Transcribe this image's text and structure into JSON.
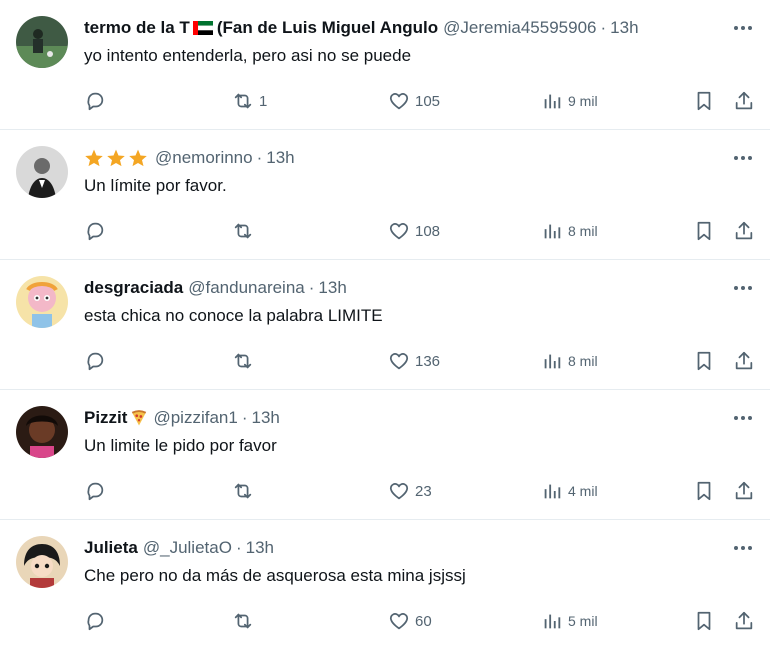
{
  "tweets": [
    {
      "name": "termo de la T",
      "name_suffix": "(Fan de Luis Miguel Angulo",
      "name_emoji": "uae-flag-icon",
      "handle": "@Jeremia45595906",
      "time": "13h",
      "text": "yo intento entenderla, pero asi no se puede",
      "replies": "",
      "retweets": "1",
      "likes": "105",
      "views": "9 mil"
    },
    {
      "name": "",
      "name_emoji": "three-stars-icon",
      "handle": "@nemorinno",
      "time": "13h",
      "text": "Un límite por favor.",
      "replies": "",
      "retweets": "",
      "likes": "108",
      "views": "8 mil"
    },
    {
      "name": "desgraciada",
      "handle": "@fandunareina",
      "time": "13h",
      "text": "esta chica no conoce la palabra LIMITE",
      "replies": "",
      "retweets": "",
      "likes": "136",
      "views": "8 mil"
    },
    {
      "name": "Pizzit",
      "name_emoji": "pizza-icon",
      "handle": "@pizzifan1",
      "time": "13h",
      "text": "Un limite le pido por favor",
      "replies": "",
      "retweets": "",
      "likes": "23",
      "views": "4 mil"
    },
    {
      "name": "Julieta",
      "handle": "@_JulietaO",
      "time": "13h",
      "text": "Che pero no da más de asquerosa esta mina jsjssj",
      "replies": "",
      "retweets": "",
      "likes": "60",
      "views": "5 mil"
    }
  ],
  "dot_separator": "·",
  "colors": {
    "text_primary": "#0f1419",
    "text_secondary": "#536471",
    "divider": "#e6ecf0",
    "star": "#f4a623"
  }
}
